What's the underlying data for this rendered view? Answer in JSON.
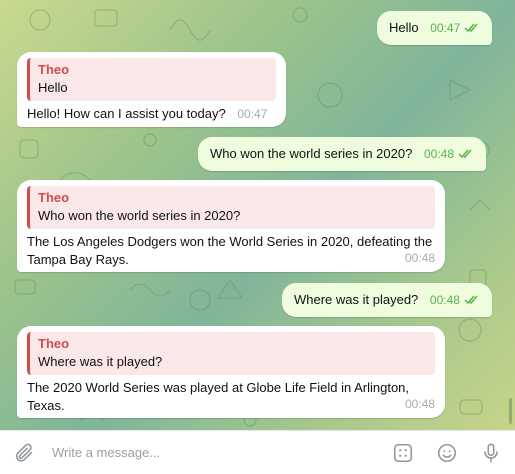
{
  "messages": [
    {
      "direction": "out",
      "text": "Hello",
      "time": "00:47"
    },
    {
      "direction": "in",
      "quote_name": "Theo",
      "quote_text": "Hello",
      "text": "Hello! How can I assist you today?",
      "time": "00:47"
    },
    {
      "direction": "out",
      "text": "Who won the world series in 2020?",
      "time": "00:48"
    },
    {
      "direction": "in",
      "quote_name": "Theo",
      "quote_text": "Who won the world series in 2020?",
      "text": "The Los Angeles Dodgers won the World Series in 2020, defeating the Tampa Bay Rays.",
      "time": "00:48"
    },
    {
      "direction": "out",
      "text": "Where was it played?",
      "time": "00:48"
    },
    {
      "direction": "in",
      "quote_name": "Theo",
      "quote_text": "Where was it played?",
      "text": "The 2020 World Series was played at Globe Life Field in Arlington, Texas.",
      "time": "00:48"
    }
  ],
  "composer": {
    "placeholder": "Write a message..."
  },
  "colors": {
    "outgoing_bubble": "#effdde",
    "incoming_bubble": "#ffffff",
    "quote_accent": "#cf4d4d",
    "quote_background": "#fae8e8",
    "read_checks": "#59b34d"
  },
  "icons": [
    "attach-icon",
    "double-check-icon",
    "commands-icon",
    "emoji-icon",
    "microphone-icon"
  ]
}
